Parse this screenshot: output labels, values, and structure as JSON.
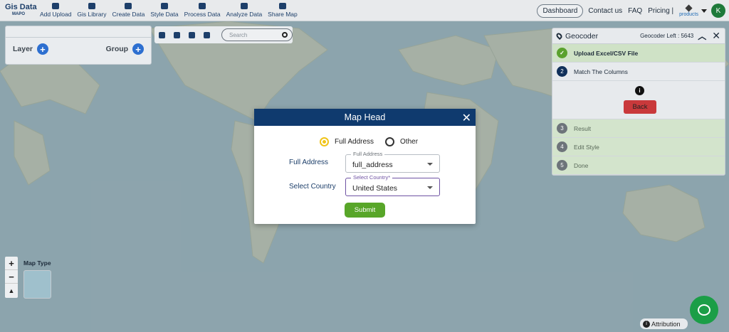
{
  "nav": {
    "logo_line1": "Gis Data",
    "logo_line2": "MAPO",
    "items": [
      {
        "label": "Add Upload",
        "icon": "cloud-upload-icon"
      },
      {
        "label": "Gis Library",
        "icon": "library-icon"
      },
      {
        "label": "Create Data",
        "icon": "map-pin-icon"
      },
      {
        "label": "Style Data",
        "icon": "paint-bucket-icon"
      },
      {
        "label": "Process Data",
        "icon": "process-icon"
      },
      {
        "label": "Analyze Data",
        "icon": "analytics-icon"
      },
      {
        "label": "Share Map",
        "icon": "share-icon"
      }
    ],
    "dashboard": "Dashboard",
    "contact": "Contact us",
    "faq": "FAQ",
    "pricing": "Pricing |",
    "products": "products",
    "avatar_letter": "K"
  },
  "layer_panel": {
    "layer_label": "Layer",
    "group_label": "Group"
  },
  "toolbar": {
    "search_placeholder": "Search"
  },
  "geocoder": {
    "title": "Geocoder",
    "left_label": "Geocoder Left : 5643",
    "steps": [
      {
        "num": "✓",
        "label": "Upload Excel/CSV File"
      },
      {
        "num": "2",
        "label": "Match The Columns"
      },
      {
        "num": "3",
        "label": "Result"
      },
      {
        "num": "4",
        "label": "Edit Style"
      },
      {
        "num": "5",
        "label": "Done"
      }
    ],
    "back_label": "Back"
  },
  "dialog": {
    "title": "Map Head",
    "radio_full": "Full Address",
    "radio_other": "Other",
    "full_address_label": "Full Address",
    "full_address_field_label": "Full Address",
    "full_address_value": "full_address",
    "country_label": "Select Country",
    "country_field_label": "Select Country*",
    "country_value": "United States",
    "submit": "Submit"
  },
  "map": {
    "map_type_label": "Map Type",
    "attribution": "Attribution"
  }
}
